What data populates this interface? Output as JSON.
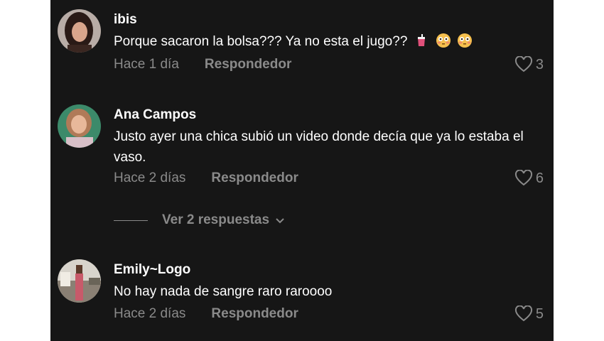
{
  "comments": [
    {
      "username": "ibis",
      "text": "Porque sacaron la bolsa??? Ya no esta el jugo??",
      "date": "Hace 1 día",
      "reply_label": "Respondedor",
      "likes": "3"
    },
    {
      "username": "Ana Campos",
      "text": "Justo ayer una chica subió un video donde decía que ya lo estaba el vaso.",
      "date": "Hace 2 días",
      "reply_label": "Respondedor",
      "likes": "6"
    },
    {
      "username": "Emily~Logo",
      "text": "No hay nada de sangre raro raroooo",
      "date": "Hace 2 días",
      "reply_label": "Respondedor",
      "likes": "5"
    }
  ],
  "view_replies_label": "Ver 2 respuestas",
  "icons": {
    "like": "heart-outline-icon",
    "chevron": "chevron-down-icon",
    "emoji_cup": "cup-with-straw-emoji",
    "emoji_face": "flushed-face-emoji"
  },
  "colors": {
    "background": "#161616",
    "text": "#ffffff",
    "muted": "#8a8a8a"
  }
}
